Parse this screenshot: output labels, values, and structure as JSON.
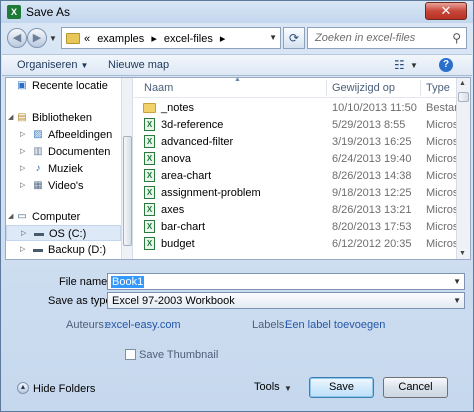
{
  "window": {
    "title": "Save As",
    "close_glyph": "✕",
    "app_icon": "X"
  },
  "address_bar": {
    "crumbs": [
      "«",
      "examples",
      "▸",
      "excel-files",
      "▸"
    ],
    "search_placeholder": "Zoeken in excel-files"
  },
  "toolbar": {
    "organize_label": "Organiseren",
    "new_folder_label": "Nieuwe map"
  },
  "nav": {
    "items": [
      {
        "label": "Recente locatie",
        "icon": "recent-icon"
      },
      {
        "label": "Bibliotheken",
        "icon": "library-icon"
      },
      {
        "label": "Afbeeldingen",
        "icon": "pictures-icon"
      },
      {
        "label": "Documenten",
        "icon": "documents-icon"
      },
      {
        "label": "Muziek",
        "icon": "music-icon"
      },
      {
        "label": "Video's",
        "icon": "videos-icon"
      },
      {
        "label": "Computer",
        "icon": "computer-icon"
      },
      {
        "label": "OS (C:)",
        "icon": "drive-icon"
      },
      {
        "label": "Backup (D:)",
        "icon": "drive-icon"
      }
    ]
  },
  "file_list": {
    "columns": [
      "Naam",
      "Gewijzigd op",
      "Type"
    ],
    "rows": [
      {
        "name": "_notes",
        "date": "10/10/2013 11:50",
        "type": "Bestand",
        "kind": "folder"
      },
      {
        "name": "3d-reference",
        "date": "5/29/2013 8:55",
        "type": "Microso",
        "kind": "excel"
      },
      {
        "name": "advanced-filter",
        "date": "3/19/2013 16:25",
        "type": "Microso",
        "kind": "excel"
      },
      {
        "name": "anova",
        "date": "6/24/2013 19:40",
        "type": "Microso",
        "kind": "excel"
      },
      {
        "name": "area-chart",
        "date": "8/26/2013 14:38",
        "type": "Microso",
        "kind": "excel"
      },
      {
        "name": "assignment-problem",
        "date": "9/18/2013 12:25",
        "type": "Microso",
        "kind": "excel"
      },
      {
        "name": "axes",
        "date": "8/26/2013 13:21",
        "type": "Microso",
        "kind": "excel"
      },
      {
        "name": "bar-chart",
        "date": "8/20/2013 17:53",
        "type": "Microso",
        "kind": "excel"
      },
      {
        "name": "budget",
        "date": "6/12/2012 20:35",
        "type": "Microso",
        "kind": "excel"
      }
    ]
  },
  "form": {
    "file_name_label": "File name:",
    "file_name_value": "Book1",
    "save_type_label": "Save as type:",
    "save_type_value": "Excel 97-2003 Workbook",
    "authors_label": "Auteurs:",
    "authors_value": "excel-easy.com",
    "labels_label": "Labels:",
    "labels_value": "Een label toevoegen",
    "thumbnail_label": "Save Thumbnail",
    "thumbnail_checked": false
  },
  "footer": {
    "hide_folders_label": "Hide Folders",
    "tools_label": "Tools",
    "save_label": "Save",
    "cancel_label": "Cancel"
  },
  "colors": {
    "accent": "#3399ff",
    "chrome": "#c9d9ec",
    "link": "#2456a6"
  }
}
